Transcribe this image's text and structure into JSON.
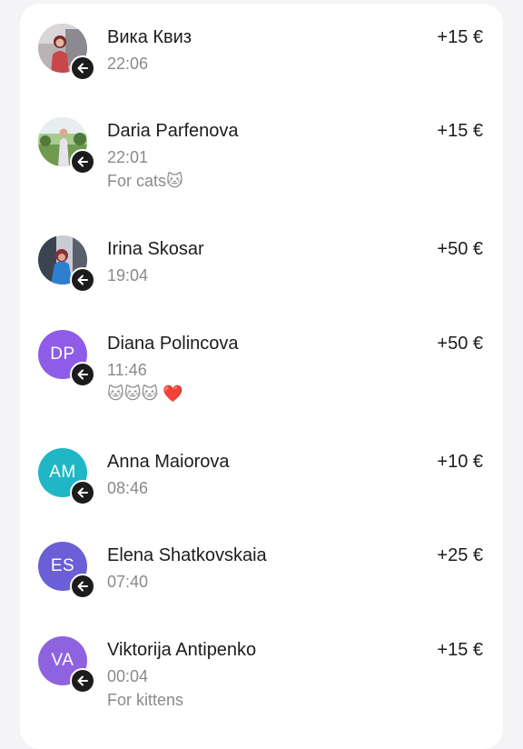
{
  "transactions": [
    {
      "name": "Вика Квиз",
      "time": "22:06",
      "amount": "+15 €",
      "note": "",
      "avatar_type": "photo",
      "initials": "",
      "avatar_color": "#8a7a72"
    },
    {
      "name": "Daria Parfenova",
      "time": "22:01",
      "amount": "+15 €",
      "note": "For cats🐱",
      "avatar_type": "photo",
      "initials": "",
      "avatar_color": "#7aa860"
    },
    {
      "name": "Irina Skosar",
      "time": "19:04",
      "amount": "+50 €",
      "note": "",
      "avatar_type": "photo",
      "initials": "",
      "avatar_color": "#5a6d80"
    },
    {
      "name": "Diana Polincova",
      "time": "11:46",
      "amount": "+50 €",
      "note": "🐱🐱🐱 ❤️",
      "avatar_type": "initials",
      "initials": "DP",
      "avatar_color": "#8e5ce6"
    },
    {
      "name": "Anna Maiorova",
      "time": "08:46",
      "amount": "+10 €",
      "note": "",
      "avatar_type": "initials",
      "initials": "AM",
      "avatar_color": "#1fb7c6"
    },
    {
      "name": "Elena Shatkovskaia",
      "time": "07:40",
      "amount": "+25 €",
      "note": "",
      "avatar_type": "initials",
      "initials": "ES",
      "avatar_color": "#6a5fd6"
    },
    {
      "name": "Viktorija Antipenko",
      "time": "00:04",
      "amount": "+15 €",
      "note": "For kittens",
      "avatar_type": "initials",
      "initials": "VA",
      "avatar_color": "#8f62e0"
    }
  ],
  "icons": {
    "incoming_badge": "arrow-left-icon"
  },
  "colors": {
    "card_background": "#ffffff",
    "page_background": "#f4f4f6",
    "primary_text": "#1c1c1e",
    "secondary_text": "#8a8a8e",
    "badge": "#1c1c1e"
  }
}
